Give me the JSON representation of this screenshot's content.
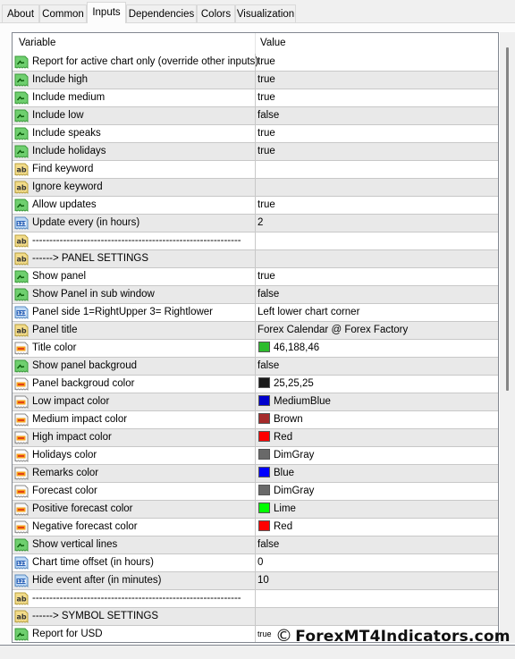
{
  "tabs": [
    {
      "label": "About",
      "active": false
    },
    {
      "label": "Common",
      "active": false
    },
    {
      "label": "Inputs",
      "active": true
    },
    {
      "label": "Dependencies",
      "active": false
    },
    {
      "label": "Colors",
      "active": false
    },
    {
      "label": "Visualization",
      "active": false
    }
  ],
  "grid": {
    "headers": {
      "variable": "Variable",
      "value": "Value"
    },
    "rows": [
      {
        "type": "bool",
        "icon": "bool-icon",
        "name": "Report for active chart only (override other inputs)",
        "value": "true"
      },
      {
        "type": "bool",
        "icon": "bool-icon",
        "name": "Include high",
        "value": "true"
      },
      {
        "type": "bool",
        "icon": "bool-icon",
        "name": "Include medium",
        "value": "true"
      },
      {
        "type": "bool",
        "icon": "bool-icon",
        "name": "Include low",
        "value": "false"
      },
      {
        "type": "bool",
        "icon": "bool-icon",
        "name": "Include speaks",
        "value": "true"
      },
      {
        "type": "bool",
        "icon": "bool-icon",
        "name": "Include holidays",
        "value": "true"
      },
      {
        "type": "string",
        "icon": "string-icon",
        "name": "Find keyword",
        "value": ""
      },
      {
        "type": "string",
        "icon": "string-icon",
        "name": "Ignore keyword",
        "value": ""
      },
      {
        "type": "bool",
        "icon": "bool-icon",
        "name": "Allow updates",
        "value": "true"
      },
      {
        "type": "int",
        "icon": "integer-icon",
        "name": "Update every (in hours)",
        "value": "2"
      },
      {
        "type": "string",
        "icon": "string-icon",
        "name": "-------------------------------------------------------------",
        "value": ""
      },
      {
        "type": "string",
        "icon": "string-icon",
        "name": "------> PANEL SETTINGS",
        "value": ""
      },
      {
        "type": "bool",
        "icon": "bool-icon",
        "name": "Show panel",
        "value": "true"
      },
      {
        "type": "bool",
        "icon": "bool-icon",
        "name": "Show Panel in sub window",
        "value": "false"
      },
      {
        "type": "int",
        "icon": "integer-icon",
        "name": "Panel side 1=RightUpper 3= Rightlower",
        "value": "Left lower chart corner"
      },
      {
        "type": "string",
        "icon": "string-icon",
        "name": "Panel title",
        "value": "Forex Calendar @ Forex Factory"
      },
      {
        "type": "color",
        "icon": "color-icon",
        "name": "Title color",
        "value": "46,188,46",
        "swatch": "#2ebc2e"
      },
      {
        "type": "bool",
        "icon": "bool-icon",
        "name": "Show panel backgroud",
        "value": "false"
      },
      {
        "type": "color",
        "icon": "color-icon",
        "name": "Panel backgroud color",
        "value": "25,25,25",
        "swatch": "#191919"
      },
      {
        "type": "color",
        "icon": "color-icon",
        "name": "Low impact color",
        "value": "MediumBlue",
        "swatch": "#0000cd"
      },
      {
        "type": "color",
        "icon": "color-icon",
        "name": "Medium impact color",
        "value": "Brown",
        "swatch": "#a52a2a"
      },
      {
        "type": "color",
        "icon": "color-icon",
        "name": "High impact color",
        "value": "Red",
        "swatch": "#ff0000"
      },
      {
        "type": "color",
        "icon": "color-icon",
        "name": "Holidays color",
        "value": "DimGray",
        "swatch": "#696969"
      },
      {
        "type": "color",
        "icon": "color-icon",
        "name": "Remarks color",
        "value": "Blue",
        "swatch": "#0000ff"
      },
      {
        "type": "color",
        "icon": "color-icon",
        "name": "Forecast color",
        "value": "DimGray",
        "swatch": "#696969"
      },
      {
        "type": "color",
        "icon": "color-icon",
        "name": "Positive forecast color",
        "value": "Lime",
        "swatch": "#00ff00"
      },
      {
        "type": "color",
        "icon": "color-icon",
        "name": "Negative forecast color",
        "value": "Red",
        "swatch": "#ff0000"
      },
      {
        "type": "bool",
        "icon": "bool-icon",
        "name": "Show vertical lines",
        "value": "false"
      },
      {
        "type": "int",
        "icon": "integer-icon",
        "name": "Chart time offset (in hours)",
        "value": "0"
      },
      {
        "type": "int",
        "icon": "integer-icon",
        "name": "Hide event after (in minutes)",
        "value": "10"
      },
      {
        "type": "string",
        "icon": "string-icon",
        "name": "-------------------------------------------------------------",
        "value": ""
      },
      {
        "type": "string",
        "icon": "string-icon",
        "name": "------> SYMBOL SETTINGS",
        "value": ""
      },
      {
        "type": "bool",
        "icon": "bool-icon",
        "name": "Report for USD",
        "value": "true",
        "small": true
      }
    ]
  },
  "watermark": {
    "copyright": "©",
    "text": "ForexMT4Indicators.com"
  }
}
